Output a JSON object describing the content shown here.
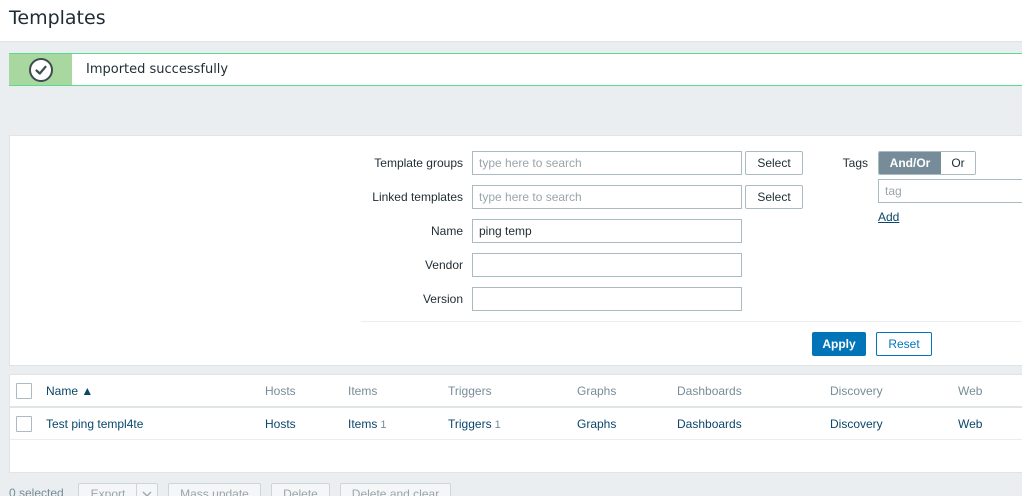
{
  "page": {
    "title": "Templates"
  },
  "message": {
    "text": "Imported successfully",
    "icon": "check-circle-icon"
  },
  "filter": {
    "template_groups_label": "Template groups",
    "template_groups_placeholder": "type here to search",
    "linked_templates_label": "Linked templates",
    "linked_templates_placeholder": "type here to search",
    "select_label": "Select",
    "name_label": "Name",
    "name_value": "ping temp",
    "vendor_label": "Vendor",
    "vendor_value": "",
    "version_label": "Version",
    "version_value": "",
    "tags_label": "Tags",
    "tags_andor": "And/Or",
    "tags_or": "Or",
    "tag_placeholder": "tag",
    "add_label": "Add",
    "apply_label": "Apply",
    "reset_label": "Reset"
  },
  "table": {
    "headers": {
      "name": "Name ▲",
      "hosts": "Hosts",
      "items": "Items",
      "triggers": "Triggers",
      "graphs": "Graphs",
      "dashboards": "Dashboards",
      "discovery": "Discovery",
      "web": "Web"
    },
    "rows": [
      {
        "name": "Test ping templ4te",
        "hosts": "Hosts",
        "items": "Items",
        "items_count": "1",
        "triggers": "Triggers",
        "triggers_count": "1",
        "graphs": "Graphs",
        "dashboards": "Dashboards",
        "discovery": "Discovery",
        "web": "Web"
      }
    ]
  },
  "actions": {
    "selected": "0 selected",
    "export": "Export",
    "mass_update": "Mass update",
    "delete": "Delete",
    "delete_clear": "Delete and clear"
  },
  "colors": {
    "accent": "#0275b8",
    "success_border": "#59db8f",
    "toggle_active": "#768d99"
  }
}
